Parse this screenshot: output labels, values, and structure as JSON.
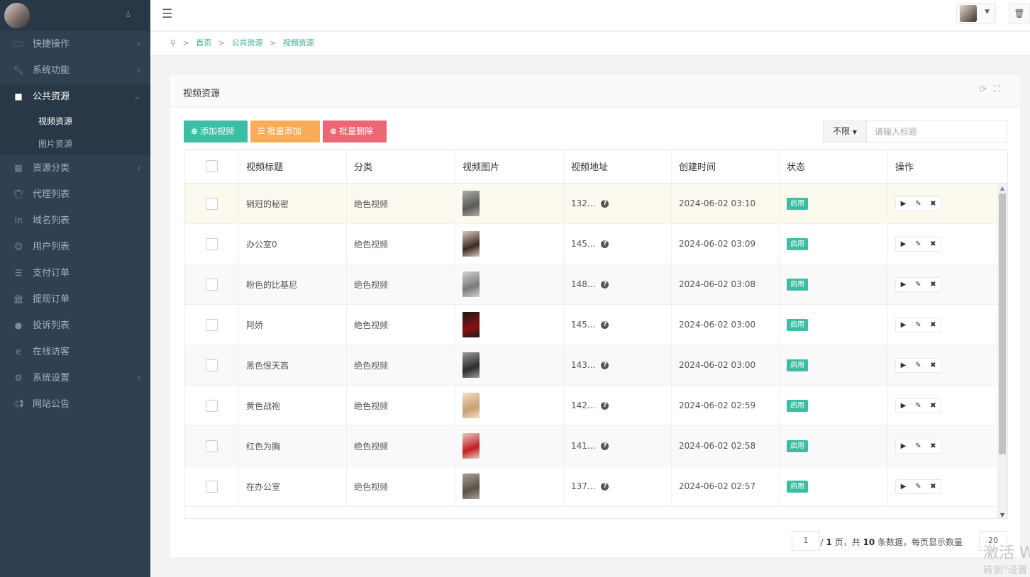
{
  "sidebar": {
    "collapse_icon": "drop-icon",
    "items": [
      {
        "label": "快捷操作",
        "icon": "folder-icon",
        "arrow": true
      },
      {
        "label": "系统功能",
        "icon": "wrench-icon",
        "arrow": true
      },
      {
        "label": "公共资源",
        "icon": "video-icon",
        "arrow": true,
        "active": true
      },
      {
        "label": "资源分类",
        "icon": "grid-icon",
        "arrow": true
      },
      {
        "label": "代理列表",
        "icon": "shirt-icon",
        "arrow": false
      },
      {
        "label": "域名列表",
        "icon": "linkedin-icon",
        "arrow": false
      },
      {
        "label": "用户列表",
        "icon": "user-icon",
        "arrow": false
      },
      {
        "label": "支付订单",
        "icon": "list-icon",
        "arrow": false
      },
      {
        "label": "提现订单",
        "icon": "bank-icon",
        "arrow": false
      },
      {
        "label": "投诉列表",
        "icon": "alert-icon",
        "arrow": false
      },
      {
        "label": "在线访客",
        "icon": "ie-icon",
        "arrow": false
      },
      {
        "label": "系统设置",
        "icon": "gear-icon",
        "arrow": true
      },
      {
        "label": "网站公告",
        "icon": "megaphone-icon",
        "arrow": false
      }
    ],
    "sub_items": [
      {
        "label": "视频资源",
        "active": true
      },
      {
        "label": "图片资源",
        "active": false
      }
    ]
  },
  "breadcrumb": {
    "home": "首页",
    "level1": "公共资源",
    "level2": "视频资源"
  },
  "panel": {
    "title": "视频资源",
    "buttons": {
      "add": "添加视频",
      "batch_add": "批量添加",
      "batch_delete": "批量删除"
    },
    "search": {
      "filter": "不限",
      "placeholder": "请输入标题"
    }
  },
  "table": {
    "columns": [
      "视频标题",
      "分类",
      "视频图片",
      "视频地址",
      "创建时间",
      "状态",
      "操作"
    ],
    "rows": [
      {
        "title": "销冠的秘密",
        "category": "绝色视频",
        "url": "132...",
        "created": "2024-06-02 03:10",
        "status": "启用",
        "thumb": [
          "#5a5a5a",
          "#b0aca6"
        ]
      },
      {
        "title": "办公室0",
        "category": "绝色视频",
        "url": "145...",
        "created": "2024-06-02 03:09",
        "status": "启用",
        "thumb": [
          "#3a2a24",
          "#d8c8b8"
        ]
      },
      {
        "title": "粉色的比基尼",
        "category": "绝色视频",
        "url": "148...",
        "created": "2024-06-02 03:08",
        "status": "启用",
        "thumb": [
          "#7a7a7a",
          "#d0d0d0"
        ]
      },
      {
        "title": "阿娇",
        "category": "绝色视频",
        "url": "145...",
        "created": "2024-06-02 03:00",
        "status": "启用",
        "thumb": [
          "#8a1010",
          "#1a1a1a"
        ]
      },
      {
        "title": "黑色恨天高",
        "category": "绝色视频",
        "url": "143...",
        "created": "2024-06-02 03:00",
        "status": "启用",
        "thumb": [
          "#2c2c2c",
          "#9a9a9a"
        ]
      },
      {
        "title": "黄色战袍",
        "category": "绝色视频",
        "url": "142...",
        "created": "2024-06-02 02:59",
        "status": "启用",
        "thumb": [
          "#c8a070",
          "#f0e0c8"
        ]
      },
      {
        "title": "红色为胸",
        "category": "绝色视频",
        "url": "141...",
        "created": "2024-06-02 02:58",
        "status": "启用",
        "thumb": [
          "#c02020",
          "#e8c8c0"
        ]
      },
      {
        "title": "在办公室",
        "category": "绝色视频",
        "url": "137...",
        "created": "2024-06-02 02:57",
        "status": "启用",
        "thumb": [
          "#5a5048",
          "#a8a098"
        ]
      }
    ]
  },
  "pagination": {
    "current_page": "1",
    "total_pages": "1",
    "total": "10",
    "page_size": "20"
  },
  "watermark": {
    "line1": "激活 W",
    "line2": "转到\"设置"
  }
}
